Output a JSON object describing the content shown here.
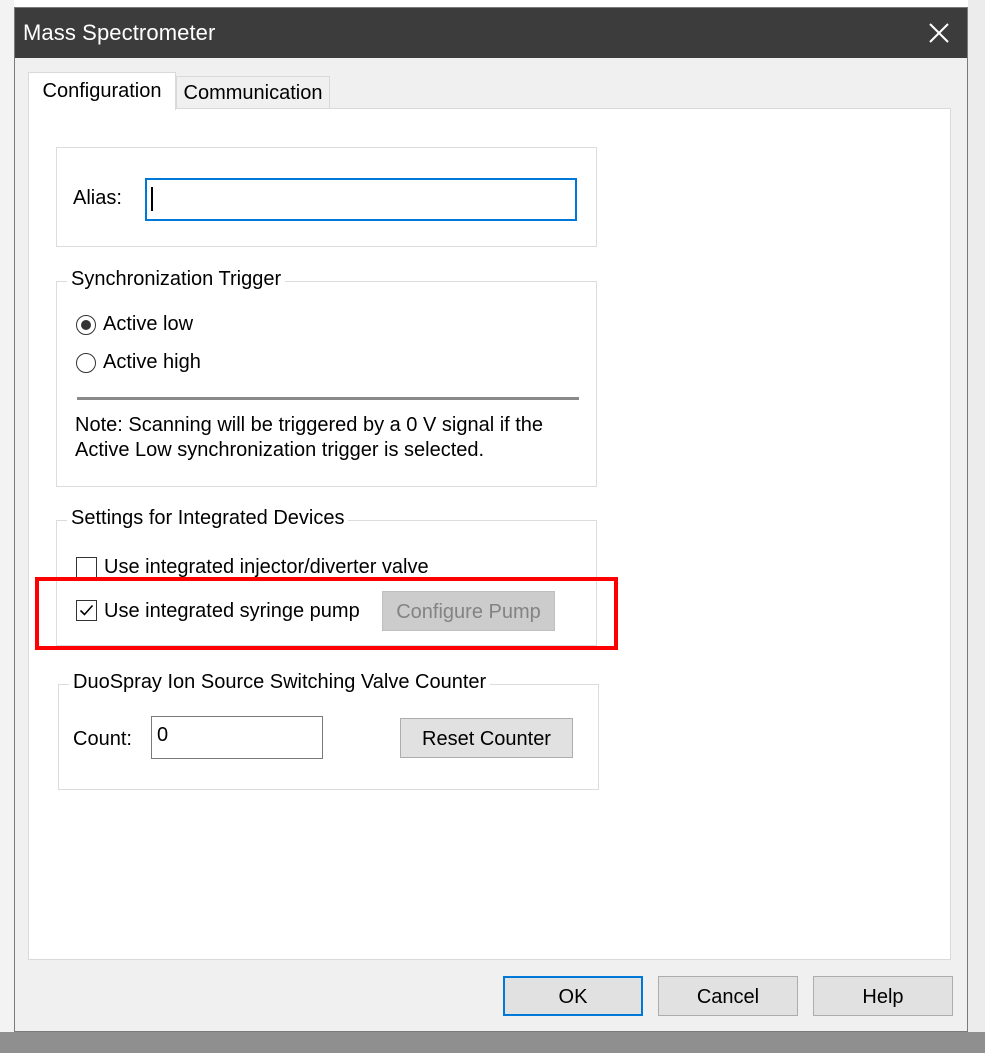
{
  "window": {
    "title": "Mass Spectrometer"
  },
  "tabs": [
    {
      "label": "Configuration"
    },
    {
      "label": "Communication"
    }
  ],
  "alias": {
    "label": "Alias:",
    "value": ""
  },
  "sync_trigger": {
    "title": "Synchronization Trigger",
    "options": [
      {
        "label": "Active low",
        "selected": true
      },
      {
        "label": "Active high",
        "selected": false
      }
    ],
    "note_line1": "Note:  Scanning will be triggered by a 0 V signal if the",
    "note_line2": "Active Low synchronization trigger is selected."
  },
  "integrated": {
    "title": "Settings for Integrated Devices",
    "injector_label": "Use integrated injector/diverter valve",
    "injector_checked": false,
    "pump_label": "Use integrated syringe pump",
    "pump_checked": true,
    "configure_pump_label": "Configure Pump"
  },
  "duospray": {
    "title": "DuoSpray Ion Source Switching Valve Counter",
    "count_label": "Count:",
    "count_value": "0",
    "reset_label": "Reset Counter"
  },
  "footer": {
    "ok_label": "OK",
    "cancel_label": "Cancel",
    "help_label": "Help"
  },
  "colors": {
    "highlight": "#ff0000",
    "titlebar": "#3c3c3c",
    "focus_border": "#0078d7"
  }
}
